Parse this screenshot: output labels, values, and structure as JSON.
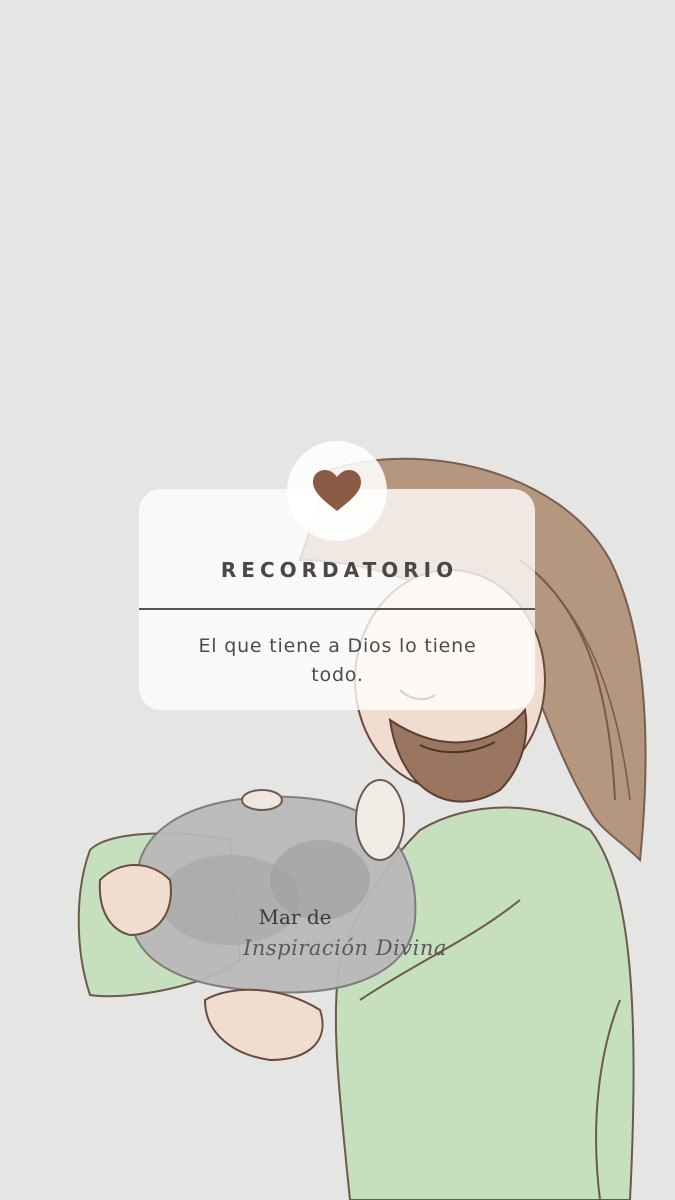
{
  "card": {
    "title": "RECORDATORIO",
    "message": "El que tiene a Dios lo tiene todo.",
    "heart_icon": "heart-icon",
    "heart_color": "#8b5a45"
  },
  "branding": {
    "line1": "Mar de",
    "line2": "Inspiración Divina"
  },
  "colors": {
    "background": "#e5e5e4",
    "robe": "#c6dfbe",
    "hair": "#a98a72",
    "skin": "#efdcce"
  }
}
